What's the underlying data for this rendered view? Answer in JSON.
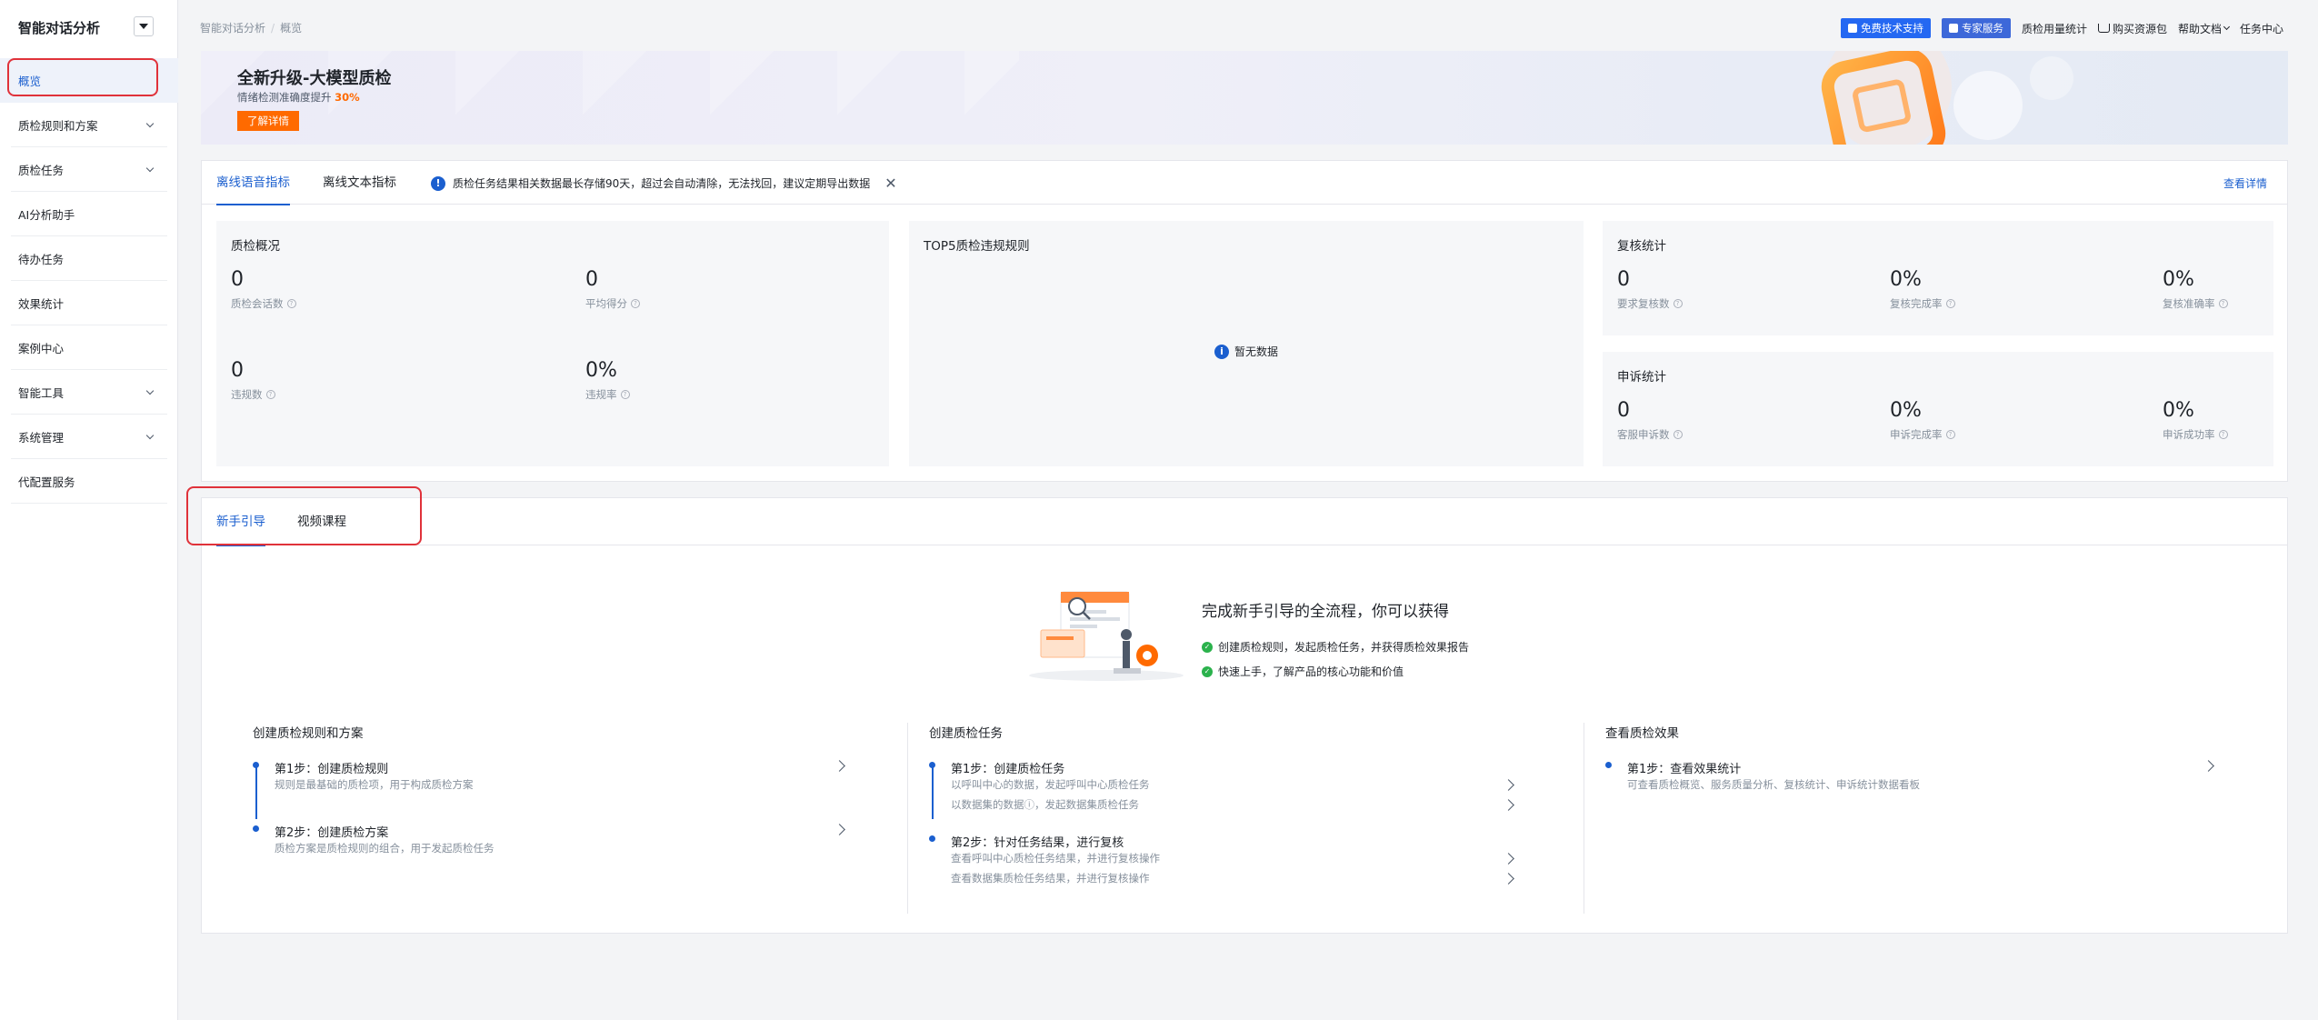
{
  "sidebar": {
    "title": "智能对话分析",
    "items": [
      {
        "label": "概览",
        "expandable": false,
        "active": true
      },
      {
        "label": "质检规则和方案",
        "expandable": true
      },
      {
        "label": "质检任务",
        "expandable": true
      },
      {
        "label": "AI分析助手",
        "expandable": false
      },
      {
        "label": "待办任务",
        "expandable": false
      },
      {
        "label": "效果统计",
        "expandable": false
      },
      {
        "label": "案例中心",
        "expandable": false
      },
      {
        "label": "智能工具",
        "expandable": true
      },
      {
        "label": "系统管理",
        "expandable": true
      },
      {
        "label": "代配置服务",
        "expandable": false
      }
    ]
  },
  "breadcrumb": {
    "root": "智能对话分析",
    "current": "概览"
  },
  "topnav": {
    "support": "免费技术支持",
    "expert": "专家服务",
    "usage": "质检用量统计",
    "buy": "购买资源包",
    "help": "帮助文档",
    "task_center": "任务中心"
  },
  "banner": {
    "title": "全新升级-大模型质检",
    "subtitle_prefix": "情绪检测准确度提升",
    "subtitle_highlight": "30%",
    "button": "了解详情"
  },
  "metrics": {
    "tabs": [
      "离线语音指标",
      "离线文本指标"
    ],
    "active_tab": 0,
    "notice": "质检任务结果相关数据最长存储90天，超过会自动清除，无法找回，建议定期导出数据",
    "view_detail": "查看详情",
    "overview": {
      "title": "质检概况",
      "stats": [
        {
          "value": "0",
          "label": "质检会话数"
        },
        {
          "value": "0",
          "label": "平均得分"
        },
        {
          "value": "0",
          "label": "违规数"
        },
        {
          "value": "0%",
          "label": "违规率"
        }
      ]
    },
    "top5": {
      "title": "TOP5质检违规规则",
      "empty": "暂无数据"
    },
    "review": {
      "title": "复核统计",
      "stats": [
        {
          "value": "0",
          "label": "要求复核数"
        },
        {
          "value": "0%",
          "label": "复核完成率"
        },
        {
          "value": "0%",
          "label": "复核准确率"
        }
      ]
    },
    "appeal": {
      "title": "申诉统计",
      "stats": [
        {
          "value": "0",
          "label": "客服申诉数"
        },
        {
          "value": "0%",
          "label": "申诉完成率"
        },
        {
          "value": "0%",
          "label": "申诉成功率"
        }
      ]
    }
  },
  "guide": {
    "tabs": [
      "新手引导",
      "视频课程"
    ],
    "active_tab": 0,
    "headline": "完成新手引导的全流程，你可以获得",
    "benefits": [
      "创建质检规则，发起质检任务，并获得质检效果报告",
      "快速上手，了解产品的核心功能和价值"
    ],
    "columns": [
      {
        "title": "创建质检规则和方案",
        "steps": [
          {
            "title": "第1步：创建质检规则",
            "desc": [
              "规则是最基础的质检项，用于构成质检方案"
            ]
          },
          {
            "title": "第2步：创建质检方案",
            "desc": [
              "质检方案是质检规则的组合，用于发起质检任务"
            ]
          }
        ]
      },
      {
        "title": "创建质检任务",
        "steps": [
          {
            "title": "第1步：创建质检任务",
            "desc": [
              "以呼叫中心的数据，发起呼叫中心质检任务",
              "以数据集的数据ⓘ，发起数据集质检任务"
            ]
          },
          {
            "title": "第2步：针对任务结果，进行复核",
            "desc": [
              "查看呼叫中心质检任务结果，并进行复核操作",
              "查看数据集质检任务结果，并进行复核操作"
            ]
          }
        ]
      },
      {
        "title": "查看质检效果",
        "steps": [
          {
            "title": "第1步：查看效果统计",
            "desc": [
              "可查看质检概览、服务质量分析、复核统计、申诉统计数据看板"
            ]
          }
        ]
      }
    ]
  },
  "colors": {
    "accent": "#1b5fcf",
    "orange": "#ff6a00",
    "highlight_box": "#e0323a"
  }
}
